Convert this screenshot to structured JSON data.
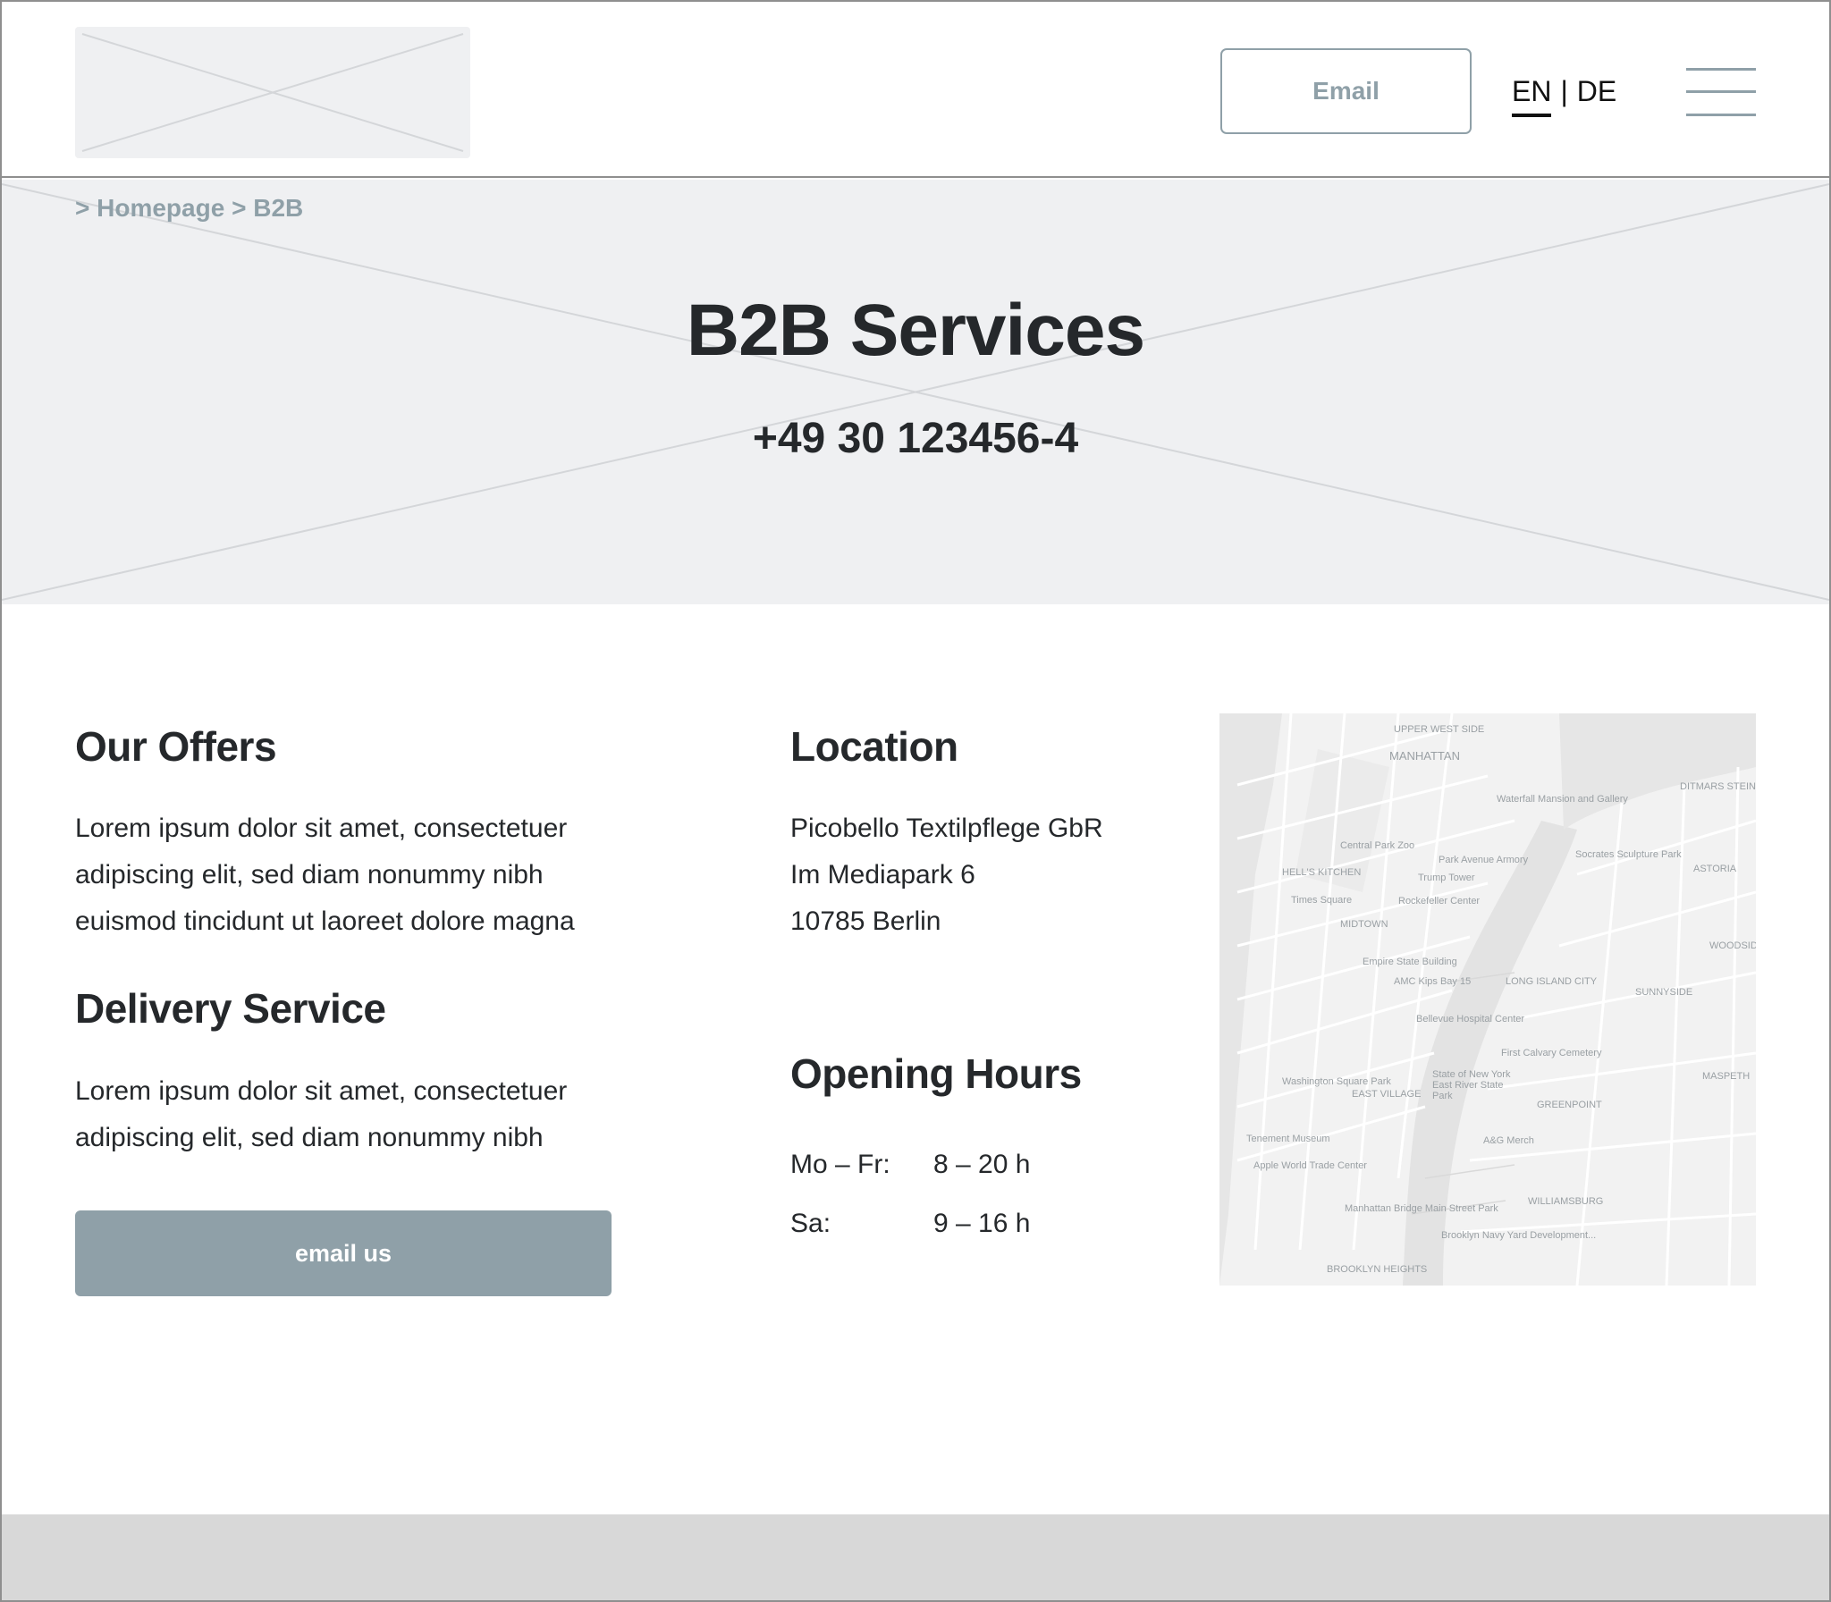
{
  "header": {
    "email_label": "Email",
    "lang": {
      "en": "EN",
      "separator": "|",
      "de": "DE"
    }
  },
  "breadcrumb": {
    "prefix1": ">",
    "item1": "Homepage",
    "prefix2": ">",
    "item2": "B2B"
  },
  "hero": {
    "title": "B2B Services",
    "phone": "+49 30 123456-4"
  },
  "offers": {
    "title": "Our Offers",
    "lines": [
      "Lorem ipsum dolor sit amet, consectetuer",
      "adipiscing elit, sed diam nonummy nibh",
      "euismod tincidunt ut laoreet dolore magna"
    ]
  },
  "delivery": {
    "title": "Delivery Service",
    "lines": [
      "Lorem ipsum dolor sit amet, consectetuer",
      "adipiscing elit, sed diam nonummy nibh"
    ],
    "button_label": "email us"
  },
  "location": {
    "title": "Location",
    "address": [
      "Picobello Textilpflege GbR",
      "Im Mediapark 6",
      "10785 Berlin"
    ]
  },
  "hours": {
    "title": "Opening Hours",
    "rows": [
      {
        "day": "Mo – Fr:",
        "time": "8 – 20 h"
      },
      {
        "day": "Sa:",
        "time": "9 – 16 h"
      }
    ]
  },
  "map": {
    "labels": [
      "MANHATTAN",
      "UPPER WEST SIDE",
      "Waterfall Mansion and Gallery",
      "Central Park Zoo",
      "Park Avenue Armory",
      "Socrates Sculpture Park",
      "ASTORIA",
      "HELL'S KITCHEN",
      "Trump Tower",
      "Times Square",
      "Rockefeller Center",
      "MIDTOWN",
      "Empire State Building",
      "AMC Kips Bay 15",
      "LONG ISLAND CITY",
      "SUNNYSIDE",
      "Bellevue Hospital Center",
      "First Calvary Cemetery",
      "Washington Square Park",
      "EAST VILLAGE",
      "GREENPOINT",
      "Tenement Museum",
      "A&G Merch",
      "Apple World Trade Center",
      "WILLIAMSBURG",
      "Manhattan Bridge Main Street Park",
      "Brooklyn Navy Yard Development...",
      "BROOKLYN HEIGHTS",
      "DITMARS STEINWAY",
      "WOODSIDE",
      "MASPETH",
      "State of New York East River State Park"
    ]
  },
  "colors": {
    "accent": "#8fa0a8",
    "text": "#25282b",
    "placeholder": "#eff0f2",
    "footer": "#d8d8d8"
  }
}
